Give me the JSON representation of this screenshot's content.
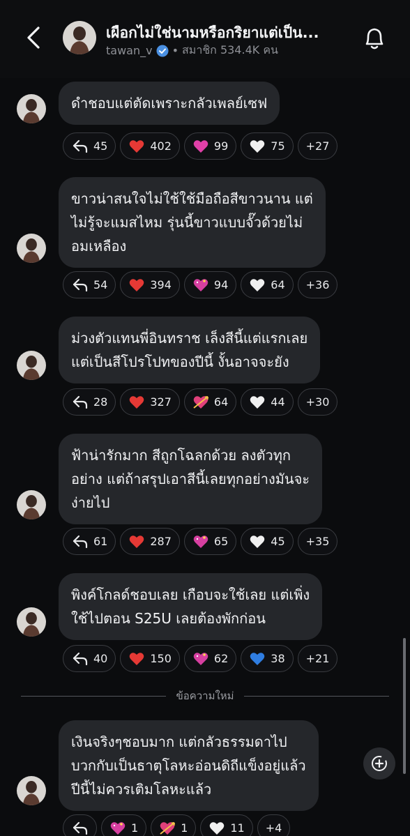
{
  "header": {
    "title": "เผือกไม่ใช่นามหรือกริยาแต่เป็น...",
    "username": "tawan_v",
    "separator": "•",
    "members_label": "สมาชิก 534.4K คน"
  },
  "colors": {
    "background": "#0b0c0e",
    "bubble": "#25272b",
    "chip_border": "#3a3c41",
    "verified": "#4a90e2"
  },
  "messages": [
    {
      "text": "ดำชอบแต่ตัดเพราะกลัวเพลย์เซฟ",
      "reactions": {
        "reply": "45",
        "r1_icon": "red-heart",
        "r1": "402",
        "r2_icon": "pink-heart",
        "r2": "99",
        "r3_icon": "white-heart",
        "r3": "75",
        "more": "+27"
      }
    },
    {
      "text_lines": [
        "ขาวน่าสนใจไม่ใช้ใช้มือถือสีขาวนาน แต่",
        "ไม่รู้จะแมสไหม รุ่นนี้ขาวแบบจั๊วด้วยไม่",
        "อมเหลือง"
      ],
      "reactions": {
        "reply": "54",
        "r1_icon": "red-heart",
        "r1": "394",
        "r2_icon": "sparkling-heart",
        "r2": "94",
        "r3_icon": "white-heart",
        "r3": "64",
        "more": "+36"
      }
    },
    {
      "text_lines": [
        "ม่วงตัวแทนพี่อินทราช เล็งสีนี้แต่แรกเลย",
        "แต่เป็นสีโปรโปทของปีนี้ งั้นอาจจะยัง"
      ],
      "reactions": {
        "reply": "28",
        "r1_icon": "red-heart",
        "r1": "327",
        "r2_icon": "heart-with-arrow",
        "r2": "64",
        "r3_icon": "white-heart",
        "r3": "44",
        "more": "+30"
      }
    },
    {
      "text_lines": [
        "ฟ้าน่ารักมาก สีถูกโฉลกด้วย ลงตัวทุก",
        "อย่าง แต่ถ้าสรุปเอาสีนี้เลยทุกอย่างมันจะ",
        "ง่ายไป"
      ],
      "reactions": {
        "reply": "61",
        "r1_icon": "red-heart",
        "r1": "287",
        "r2_icon": "sparkling-heart",
        "r2": "65",
        "r3_icon": "white-heart",
        "r3": "45",
        "more": "+35"
      }
    },
    {
      "text_lines": [
        "พิงค์โกลด์ชอบเลย เกือบจะใช้เลย แต่เพิ่ง",
        "ใช้ไปตอน S25U เลยต้องพักก่อน"
      ],
      "reactions": {
        "reply": "40",
        "r1_icon": "red-heart",
        "r1": "150",
        "r2_icon": "sparkling-heart",
        "r2": "62",
        "r3_icon": "blue-heart",
        "r3": "38",
        "more": "+21"
      }
    },
    {
      "text_lines": [
        "เงินจริงๆชอบมาก แต่กลัวธรรมดาไป",
        "บวกกับเป็นธาตุโลหะอ่อนดิถีแข็งอยู่แล้ว",
        "ปีนี้ไม่ควรเติมโลหะแล้ว"
      ],
      "reactions": {
        "r1_icon": "sparkling-heart",
        "r1": "1",
        "r2_icon": "heart-with-arrow",
        "r2": "1",
        "r3_icon": "white-heart",
        "r3": "11",
        "more": "+4"
      }
    }
  ],
  "divider_label": "ข้อความใหม่"
}
